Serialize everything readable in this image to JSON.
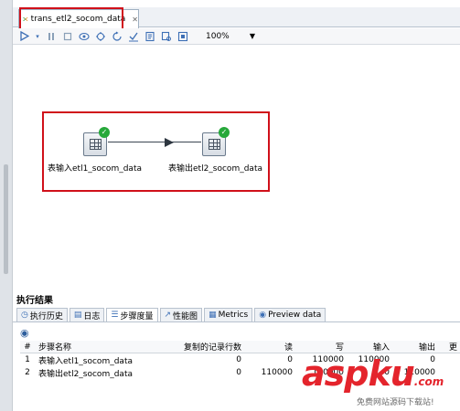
{
  "editor_tab": {
    "label": "trans_etl2_socom_data"
  },
  "toolbar": {
    "zoom": "100%"
  },
  "canvas": {
    "steps": [
      {
        "label": "表输入etl1_socom_data"
      },
      {
        "label": "表输出etl2_socom_data"
      }
    ]
  },
  "results": {
    "title": "执行结果",
    "tabs": [
      {
        "label": "执行历史",
        "icon": "history-icon"
      },
      {
        "label": "日志",
        "icon": "log-icon"
      },
      {
        "label": "步骤度量",
        "icon": "metrics-list-icon"
      },
      {
        "label": "性能图",
        "icon": "chart-icon"
      },
      {
        "label": "Metrics",
        "icon": "metrics-icon"
      },
      {
        "label": "Preview data",
        "icon": "eye-icon"
      }
    ],
    "columns": [
      "#",
      "步骤名称",
      "复制的记录行数",
      "读",
      "写",
      "输入",
      "输出",
      "更"
    ],
    "rows": [
      [
        "1",
        "表输入etl1_socom_data",
        "0",
        "0",
        "110000",
        "110000",
        "0",
        ""
      ],
      [
        "2",
        "表输出etl2_socom_data",
        "0",
        "110000",
        "110000",
        "0",
        "110000",
        ""
      ]
    ]
  },
  "watermark": {
    "text": "aspku",
    "dot": ".com",
    "sub": "免费网站源码下载站!"
  },
  "colors": {
    "highlight": "#d0101a",
    "success": "#26a83a",
    "accent": "#3d6fb5"
  }
}
